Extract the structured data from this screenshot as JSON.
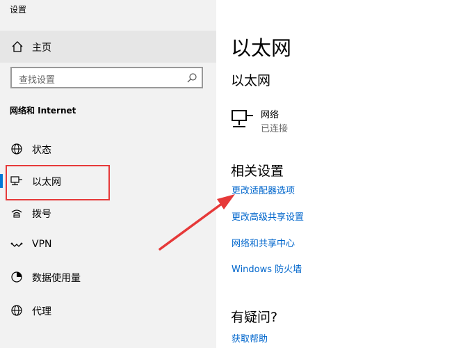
{
  "window": {
    "title": "设置"
  },
  "sidebar": {
    "home_label": "主页",
    "search": {
      "placeholder": "查找设置"
    },
    "section_title": "网络和 Internet",
    "items": [
      {
        "label": "状态",
        "icon": "globe-icon"
      },
      {
        "label": "以太网",
        "icon": "ethernet-icon",
        "selected": true
      },
      {
        "label": "拨号",
        "icon": "dialup-icon"
      },
      {
        "label": "VPN",
        "icon": "vpn-icon"
      },
      {
        "label": "数据使用量",
        "icon": "data-usage-icon"
      },
      {
        "label": "代理",
        "icon": "proxy-globe-icon"
      }
    ]
  },
  "main": {
    "title": "以太网",
    "subtitle": "以太网",
    "network": {
      "name": "网络",
      "status": "已连接"
    },
    "related": {
      "title": "相关设置",
      "links": [
        "更改适配器选项",
        "更改高级共享设置",
        "网络和共享中心",
        "Windows 防火墙"
      ]
    },
    "help": {
      "title": "有疑问?",
      "link": "获取帮助"
    }
  },
  "colors": {
    "accent": "#0078d7",
    "link": "#0066cc",
    "annotation": "#e63939",
    "sidebar_bg": "#f2f2f2"
  }
}
